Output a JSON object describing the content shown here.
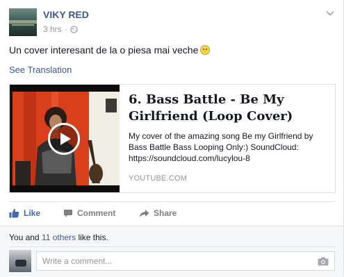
{
  "post": {
    "author": "VIKY RED",
    "time": "3 hrs",
    "separator": "·",
    "text": "Un cover interesant de la o piesa mai veche",
    "see_translation": "See Translation"
  },
  "link_card": {
    "title": "6. Bass Battle - Be My Girlfriend (Loop Cover)",
    "description": "My cover of the amazing song Be my Girlfriend by Bass Battle Bass Looping Only:) SoundCloud: https://soundcloud.com/lucylou-8",
    "source": "YOUTUBE.COM"
  },
  "actions": {
    "like": "Like",
    "comment": "Comment",
    "share": "Share"
  },
  "likes": {
    "prefix": "You and ",
    "others": "11 others",
    "suffix": " like this."
  },
  "comment_input": {
    "placeholder": "Write a comment..."
  },
  "icons": {
    "privacy": "globe-icon",
    "menu": "chevron-down-icon",
    "like": "thumbs-up-icon",
    "comment": "speech-bubble-icon",
    "share": "share-arrow-icon",
    "camera": "camera-icon",
    "play": "play-icon",
    "emoji": "smiley-icon"
  },
  "colors": {
    "link_blue": "#3b5998",
    "like_blue": "#4267b2",
    "muted_text": "#9197a3",
    "footer_bg": "#f6f7f9"
  }
}
